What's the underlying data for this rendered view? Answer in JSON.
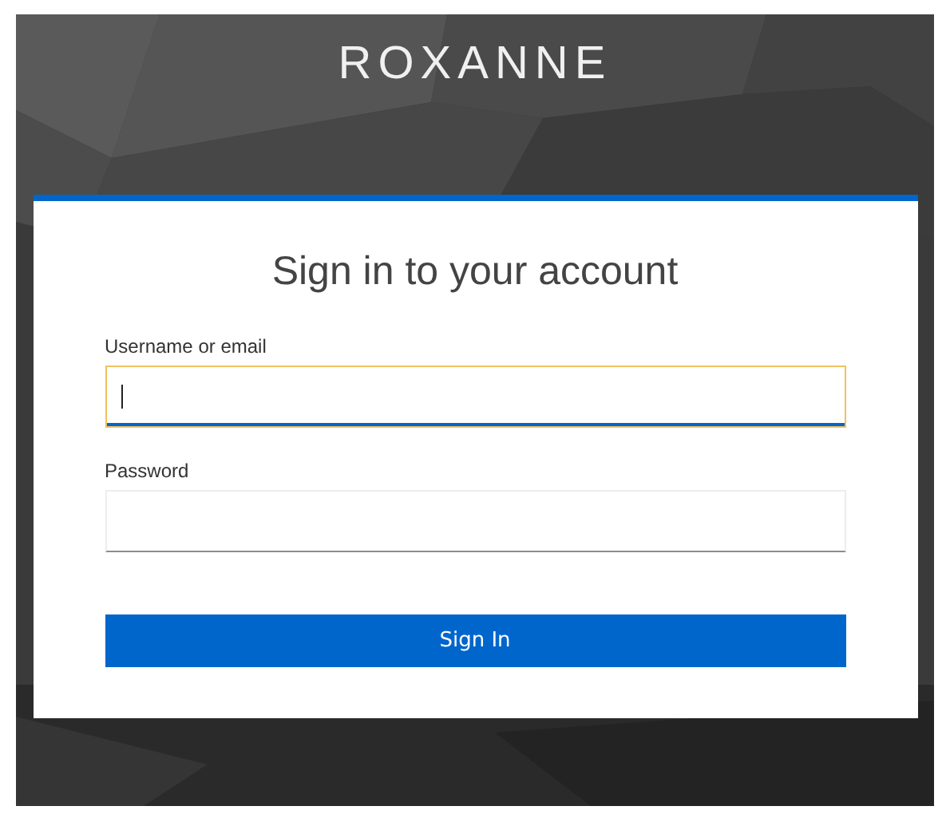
{
  "brand": "ROXANNE",
  "login": {
    "heading": "Sign in to your account",
    "fields": [
      {
        "label": "Username or email",
        "focused": true
      },
      {
        "label": "Password",
        "focused": false
      }
    ],
    "submit": "Sign In"
  }
}
